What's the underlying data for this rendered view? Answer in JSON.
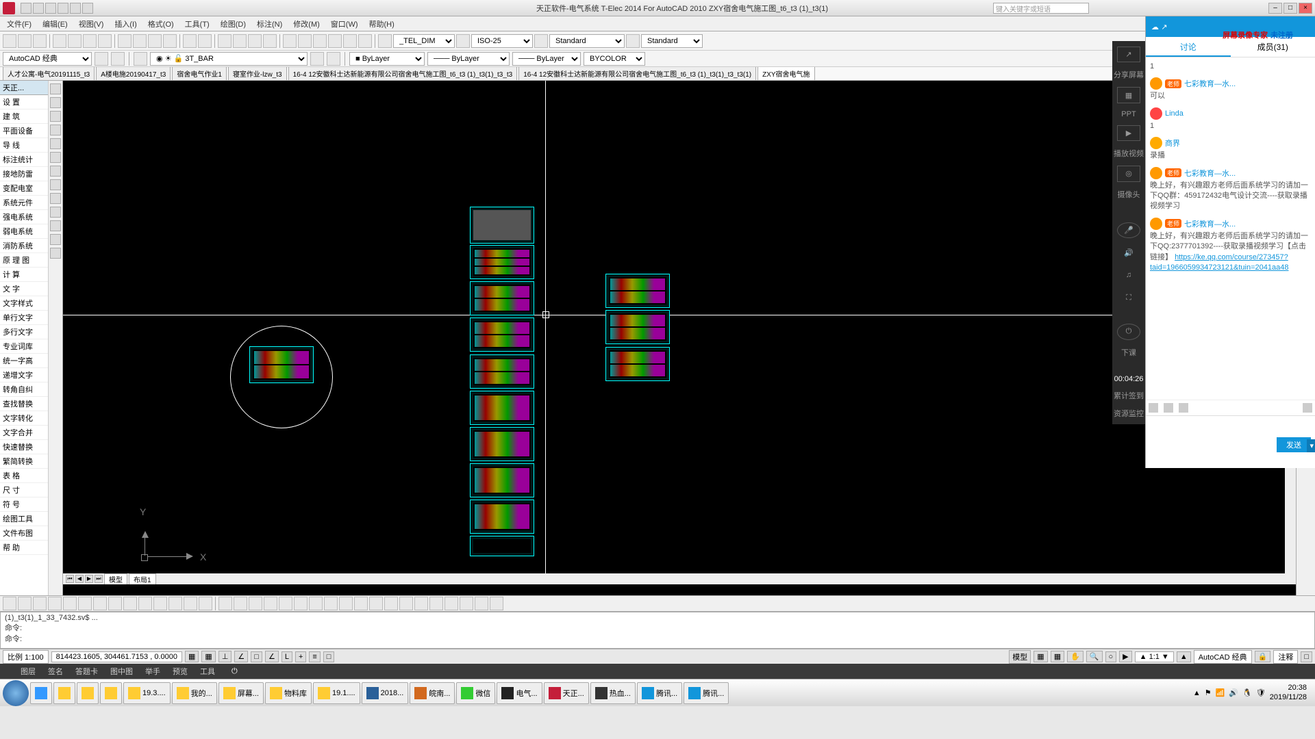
{
  "title": "天正软件-电气系统 T-Elec 2014  For AutoCAD 2010      ZXY宿舍电气施工图_t6_t3 (1)_t3(1)",
  "search_placeholder": "键入关键字或短语",
  "recorder": {
    "text1": "屏幕录像专家",
    "text2": "未注册"
  },
  "menu": [
    "文件(F)",
    "编辑(E)",
    "视图(V)",
    "插入(I)",
    "格式(O)",
    "工具(T)",
    "绘图(D)",
    "标注(N)",
    "修改(M)",
    "窗口(W)",
    "帮助(H)"
  ],
  "style_sel1": "_TEL_DIM",
  "style_sel2": "ISO-25",
  "style_sel3": "Standard",
  "style_sel4": "Standard",
  "workspace": "AutoCAD 经典",
  "layer": "3T_BAR",
  "bylayer": "ByLayer",
  "bycolor": "BYCOLOR",
  "doc_tabs": [
    {
      "label": "人才公寓-电气20191115_t3"
    },
    {
      "label": "A楼电施20190417_t3"
    },
    {
      "label": "宿舍电气作业1"
    },
    {
      "label": "寝室作业-lzw_t3"
    },
    {
      "label": "16-4   12安徽科士达新能源有限公司宿舍电气施工图_t6_t3  (1)_t3(1)_t3_t3"
    },
    {
      "label": "16-4   12安徽科士达新能源有限公司宿舍电气施工图_t6_t3  (1)_t3(1)_t3_t3(1)"
    },
    {
      "label": "ZXY宿舍电气施"
    }
  ],
  "left_panel": {
    "header": "天正...",
    "items": [
      "设    置",
      "建    筑",
      "平面设备",
      "导    线",
      "标注统计",
      "接地防雷",
      "变配电室",
      "系统元件",
      "强电系统",
      "弱电系统",
      "消防系统",
      "原 理 图",
      "计    算",
      "文    字",
      "文字样式",
      "单行文字",
      "多行文字",
      "专业词库",
      "统一字高",
      "递增文字",
      "转角自纠",
      "查找替换",
      "文字转化",
      "文字合并",
      "快速替换",
      "繁简转换",
      "表    格",
      "尺    寸",
      "符    号",
      "绘图工具",
      "文件布图",
      "帮    助"
    ]
  },
  "model_tabs": {
    "model": "模型",
    "layout": "布局1"
  },
  "cmd": {
    "line1": "(1)_t3(1)_1_33_7432.sv$ ...",
    "line2": "命令:",
    "line3": "命令:"
  },
  "status": {
    "scale": "比例 1:100",
    "coords": "814423.1605, 304461.7153 , 0.0000",
    "ws": "AutoCAD 经典",
    "ann": "注释"
  },
  "tangent_bar": [
    "图层",
    "签名",
    "答题卡",
    "图中图",
    "举手",
    "预览",
    "工具"
  ],
  "chat": {
    "header": "分享屏幕",
    "tab1": "讨论",
    "tab2": "成员(31)",
    "side": {
      "share": "分享屏幕",
      "ppt": "PPT",
      "video": "播放视频",
      "cam": "摄像头",
      "timer": "00:04:26",
      "stats": "累计签到",
      "res": "资源监控",
      "end": "下课"
    },
    "msgs": [
      {
        "n": "",
        "t": "1"
      },
      {
        "n": "七彩教育—水...",
        "t": "可以",
        "badge": "老师"
      },
      {
        "n": "Linda",
        "t": "1"
      },
      {
        "n": "商界",
        "t": "录播"
      },
      {
        "n": "七彩教育—水...",
        "t": "晚上好，有兴趣跟方老师后面系统学习的请加一下QQ群：459172432电气设计交流----获取录播视频学习",
        "badge": "老师"
      },
      {
        "n": "七彩教育—水...",
        "t": "晚上好，有兴趣跟方老师后面系统学习的请加一下QQ:2377701392----获取录播视频学习【点击链接】",
        "link": "https://ke.qq.com/course/273457?taid=1966059934723121&tuin=2041aa48",
        "badge": "老师"
      }
    ],
    "send": "发送"
  },
  "taskbar": [
    {
      "l": "19.3....",
      "c": "#fc3"
    },
    {
      "l": "我的...",
      "c": "#fc3"
    },
    {
      "l": "屏幕...",
      "c": "#fc3"
    },
    {
      "l": "物料库",
      "c": "#fc3"
    },
    {
      "l": "19.1....",
      "c": "#fc3"
    },
    {
      "l": "2018...",
      "c": "#2a6099"
    },
    {
      "l": "皖南...",
      "c": "#d2691e"
    },
    {
      "l": "微信",
      "c": "#3c3"
    },
    {
      "l": "电气...",
      "c": "#222"
    },
    {
      "l": "天正...",
      "c": "#c41e3a"
    },
    {
      "l": "热血...",
      "c": "#333"
    },
    {
      "l": "腾讯...",
      "c": "#1296db"
    },
    {
      "l": "腾讯...",
      "c": "#1296db"
    }
  ],
  "clock": {
    "time": "20:38",
    "date": "2019/11/28"
  }
}
